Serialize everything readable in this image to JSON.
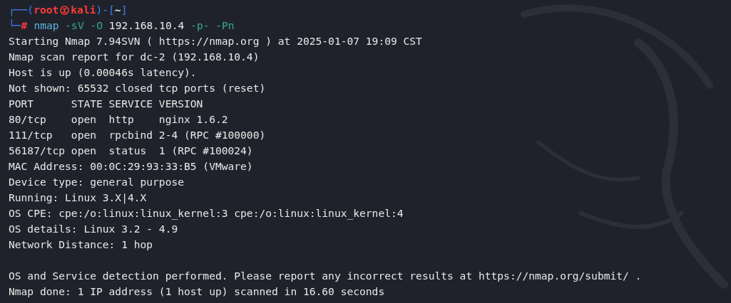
{
  "prompt": {
    "top_left": "┌──(",
    "user": "root",
    "host": "kali",
    "mid": ")-[",
    "cwd": "~",
    "end": "]",
    "bottom_left": "└─",
    "symbol": "#"
  },
  "command": [
    {
      "kind": "program",
      "text": "nmap"
    },
    {
      "kind": "option",
      "text": "-sV"
    },
    {
      "kind": "option",
      "text": "-O"
    },
    {
      "kind": "argument",
      "text": "192.168.10.4"
    },
    {
      "kind": "option",
      "text": "-p-"
    },
    {
      "kind": "option",
      "text": "-Pn"
    }
  ],
  "output_blocks": [
    [
      "Starting Nmap 7.94SVN ( https://nmap.org ) at 2025-01-07 19:09 CST",
      "Nmap scan report for dc-2 (192.168.10.4)",
      "Host is up (0.00046s latency).",
      "Not shown: 65532 closed tcp ports (reset)",
      "PORT      STATE SERVICE VERSION",
      "80/tcp    open  http    nginx 1.6.2",
      "111/tcp   open  rpcbind 2-4 (RPC #100000)",
      "56187/tcp open  status  1 (RPC #100024)",
      "MAC Address: 00:0C:29:93:33:B5 (VMware)",
      "Device type: general purpose",
      "Running: Linux 3.X|4.X",
      "OS CPE: cpe:/o:linux:linux_kernel:3 cpe:/o:linux:linux_kernel:4",
      "OS details: Linux 3.2 - 4.9",
      "Network Distance: 1 hop"
    ],
    [
      "OS and Service detection performed. Please report any incorrect results at https://nmap.org/submit/ .",
      "Nmap done: 1 IP address (1 host up) scanned in 16.60 seconds"
    ]
  ]
}
